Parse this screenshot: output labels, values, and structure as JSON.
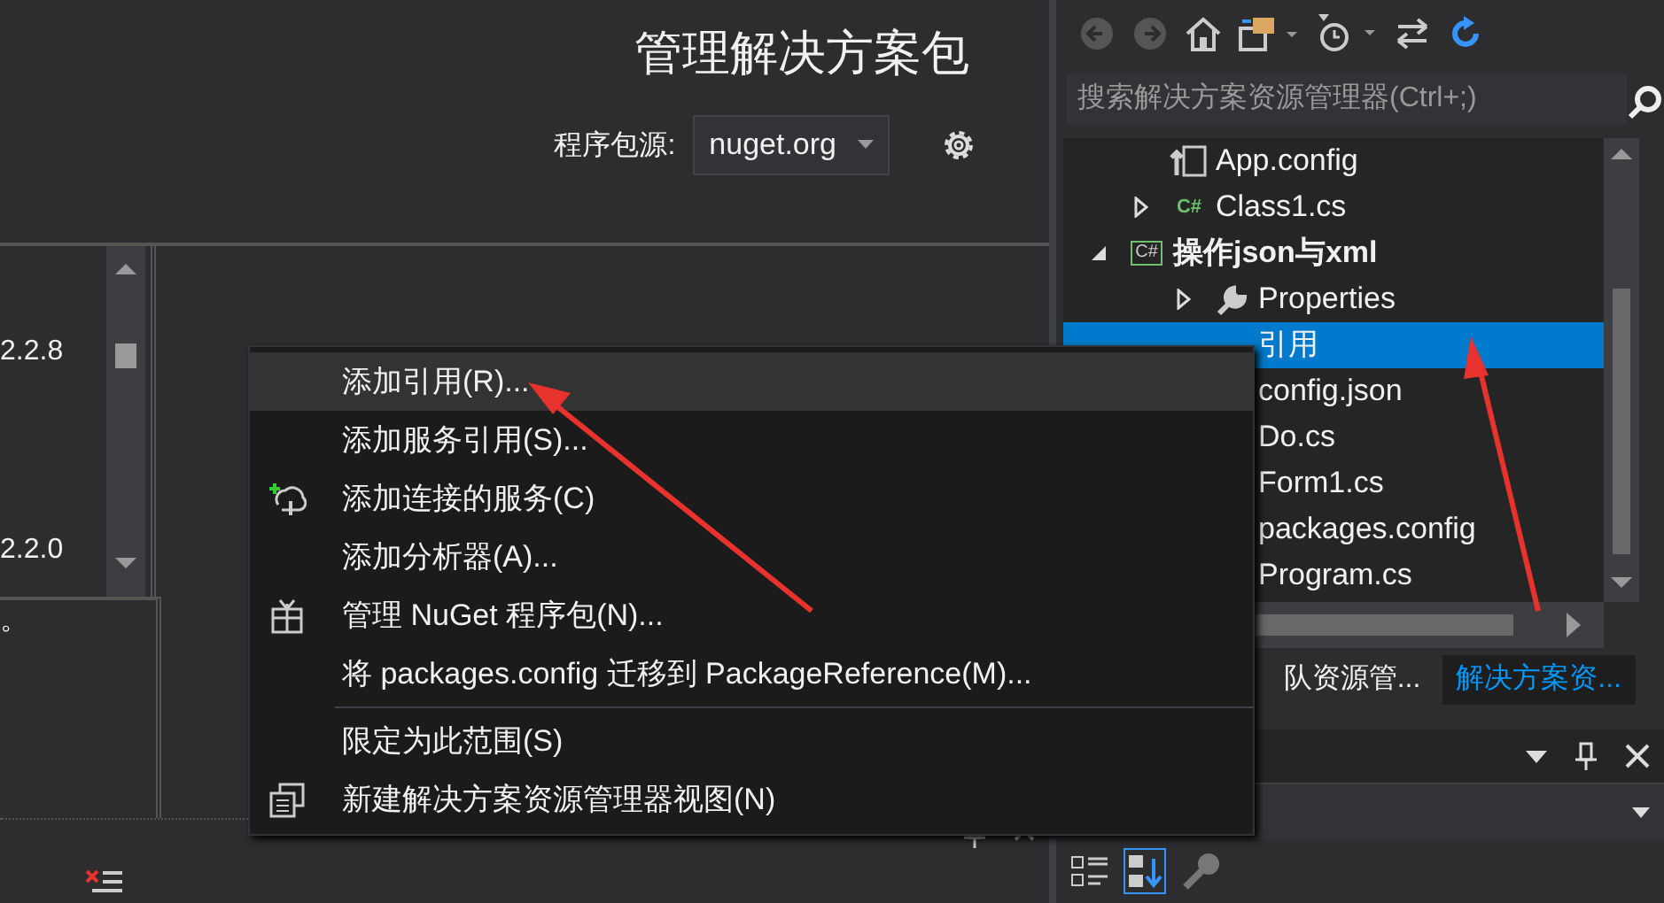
{
  "package_manager": {
    "title": "管理解决方案包",
    "source_label": "程序包源:",
    "source_value": "nuget.org",
    "versions": [
      "2.2.8",
      "2.2.0"
    ],
    "description": "。"
  },
  "solution_explorer": {
    "search": {
      "placeholder": "搜索解决方案资源管理器(Ctrl+;)"
    },
    "tree": [
      {
        "label": "App.config",
        "kind": "config",
        "selected": false
      },
      {
        "label": "Class1.cs",
        "kind": "csharp",
        "icon_text": "C#",
        "expanded": false,
        "selected": false
      },
      {
        "label": "操作json与xml",
        "kind": "project",
        "icon_text": "C#",
        "expanded": true,
        "selected": false,
        "children": [
          {
            "label": "Properties",
            "kind": "properties",
            "expanded": false,
            "selected": false
          },
          {
            "label": "引用",
            "kind": "references",
            "selected": true
          },
          {
            "label": "config.json",
            "kind": "file",
            "selected": false
          },
          {
            "label": "Do.cs",
            "kind": "file",
            "selected": false
          },
          {
            "label": "Form1.cs",
            "kind": "file",
            "selected": false
          },
          {
            "label": "packages.config",
            "kind": "file",
            "selected": false
          },
          {
            "label": "Program.cs",
            "kind": "file",
            "selected": false
          }
        ]
      }
    ],
    "tabs": [
      {
        "label": "队资源管...",
        "selected": false
      },
      {
        "label": "解决方案资...",
        "selected": true
      }
    ]
  },
  "context_menu": {
    "items": [
      {
        "kind": "command",
        "label": "添加引用(R)...",
        "selected": true
      },
      {
        "kind": "command",
        "label": "添加服务引用(S)...",
        "selected": false
      },
      {
        "kind": "command",
        "label": "添加连接的服务(C)",
        "selected": false
      },
      {
        "kind": "command",
        "label": "添加分析器(A)...",
        "selected": false
      },
      {
        "kind": "command",
        "label": "管理 NuGet 程序包(N)...",
        "selected": false
      },
      {
        "kind": "command",
        "label": "将 packages.config 迁移到 PackageReference(M)...",
        "selected": false
      },
      {
        "kind": "separator"
      },
      {
        "kind": "command",
        "label": "限定为此范围(S)",
        "selected": false
      },
      {
        "kind": "command",
        "label": "新建解决方案资源管理器视图(N)",
        "selected": false
      }
    ]
  }
}
